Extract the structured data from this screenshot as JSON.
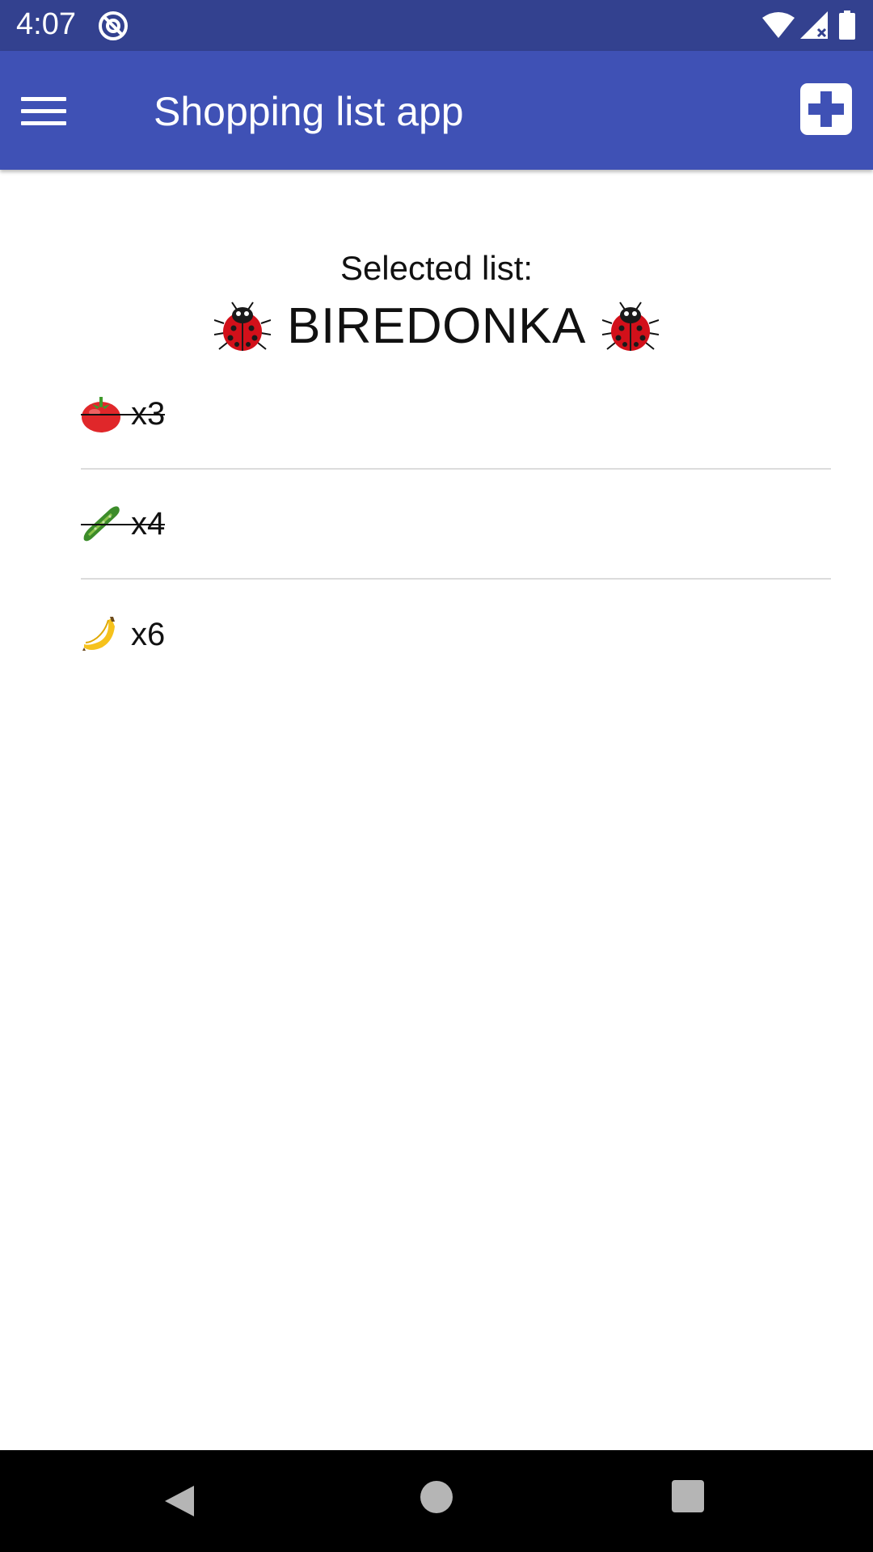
{
  "status_bar": {
    "time": "4:07",
    "icons": [
      "notification-icon",
      "wifi-icon",
      "signal-icon",
      "battery-icon"
    ]
  },
  "app_bar": {
    "title": "Shopping list app",
    "menu_icon": "hamburger-menu-icon",
    "add_icon": "add-box-icon",
    "color": "#3f51b5",
    "status_color": "#33418f"
  },
  "list": {
    "label": "Selected list:",
    "name": "BIREDONKA",
    "decoration_icon": "ladybug-icon"
  },
  "items": [
    {
      "icon": "tomato-icon",
      "quantity": "x3",
      "checked": true
    },
    {
      "icon": "cucumber-icon",
      "quantity": "x4",
      "checked": true
    },
    {
      "icon": "banana-icon",
      "quantity": "x6",
      "checked": false
    }
  ],
  "nav_bar": {
    "icons": [
      "back-icon",
      "home-icon",
      "recents-icon"
    ]
  }
}
